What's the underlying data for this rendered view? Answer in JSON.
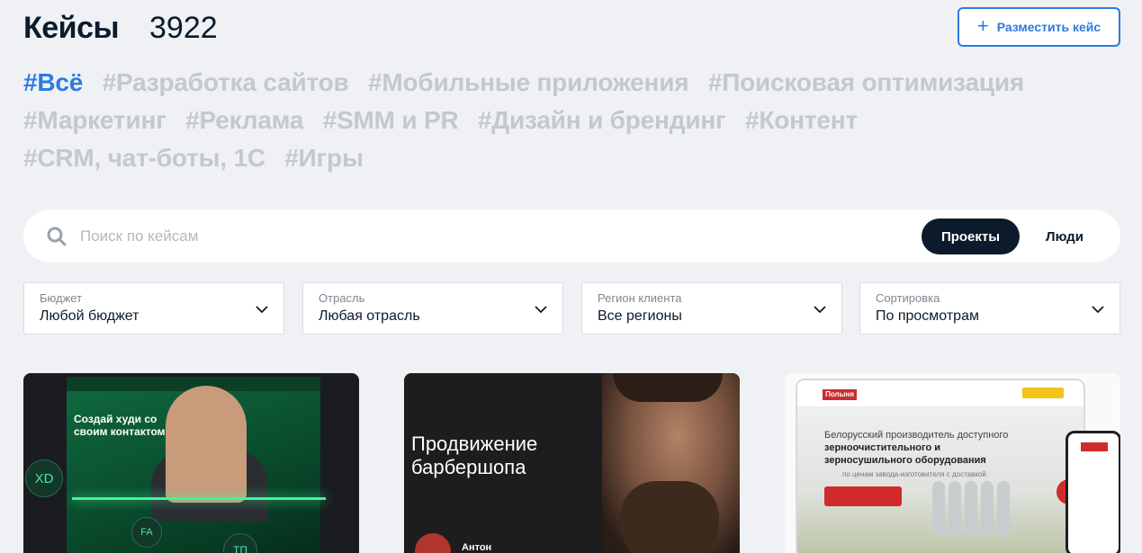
{
  "header": {
    "title": "Кейсы",
    "count": "3922",
    "post_button": {
      "icon": "plus-icon",
      "label": "Разместить кейс"
    }
  },
  "tags": [
    [
      "#Всё",
      "#Разработка сайтов",
      "#Мобильные приложения",
      "#Поисковая оптимизация"
    ],
    [
      "#Маркетинг",
      "#Реклама",
      "#SMM и PR",
      "#Дизайн и брендинг",
      "#Контент"
    ],
    [
      "#CRM, чат-боты, 1С",
      "#Игры"
    ]
  ],
  "active_tag": "#Всё",
  "search": {
    "icon": "search-icon",
    "placeholder": "Поиск по кейсам",
    "value": "",
    "segments": [
      "Проекты",
      "Люди"
    ],
    "selected_segment": "Проекты"
  },
  "filters": [
    {
      "label": "Бюджет",
      "value": "Любой бюджет"
    },
    {
      "label": "Отрасль",
      "value": "Любая отрасль"
    },
    {
      "label": "Регион клиента",
      "value": "Все регионы"
    },
    {
      "label": "Сортировка",
      "value": "По просмотрам"
    }
  ],
  "cards": [
    {
      "headline": "Создай худи со своим контактом",
      "badges": [
        "XD",
        "FA",
        "ТП"
      ]
    },
    {
      "headline": "Продвижение барбершопа",
      "author": "Антон"
    },
    {
      "logo": "Полыня",
      "headline_plain": "Белорусский производитель доступного",
      "headline_bold": "зерноочистительного и зерносушильного оборудования",
      "subline": "по ценам завода-изготовителя с доставкой"
    }
  ],
  "colors": {
    "accent": "#2d7be0",
    "dark": "#0b1b2b",
    "tag_inactive": "#c4c8cf",
    "background": "#eff1f4"
  }
}
